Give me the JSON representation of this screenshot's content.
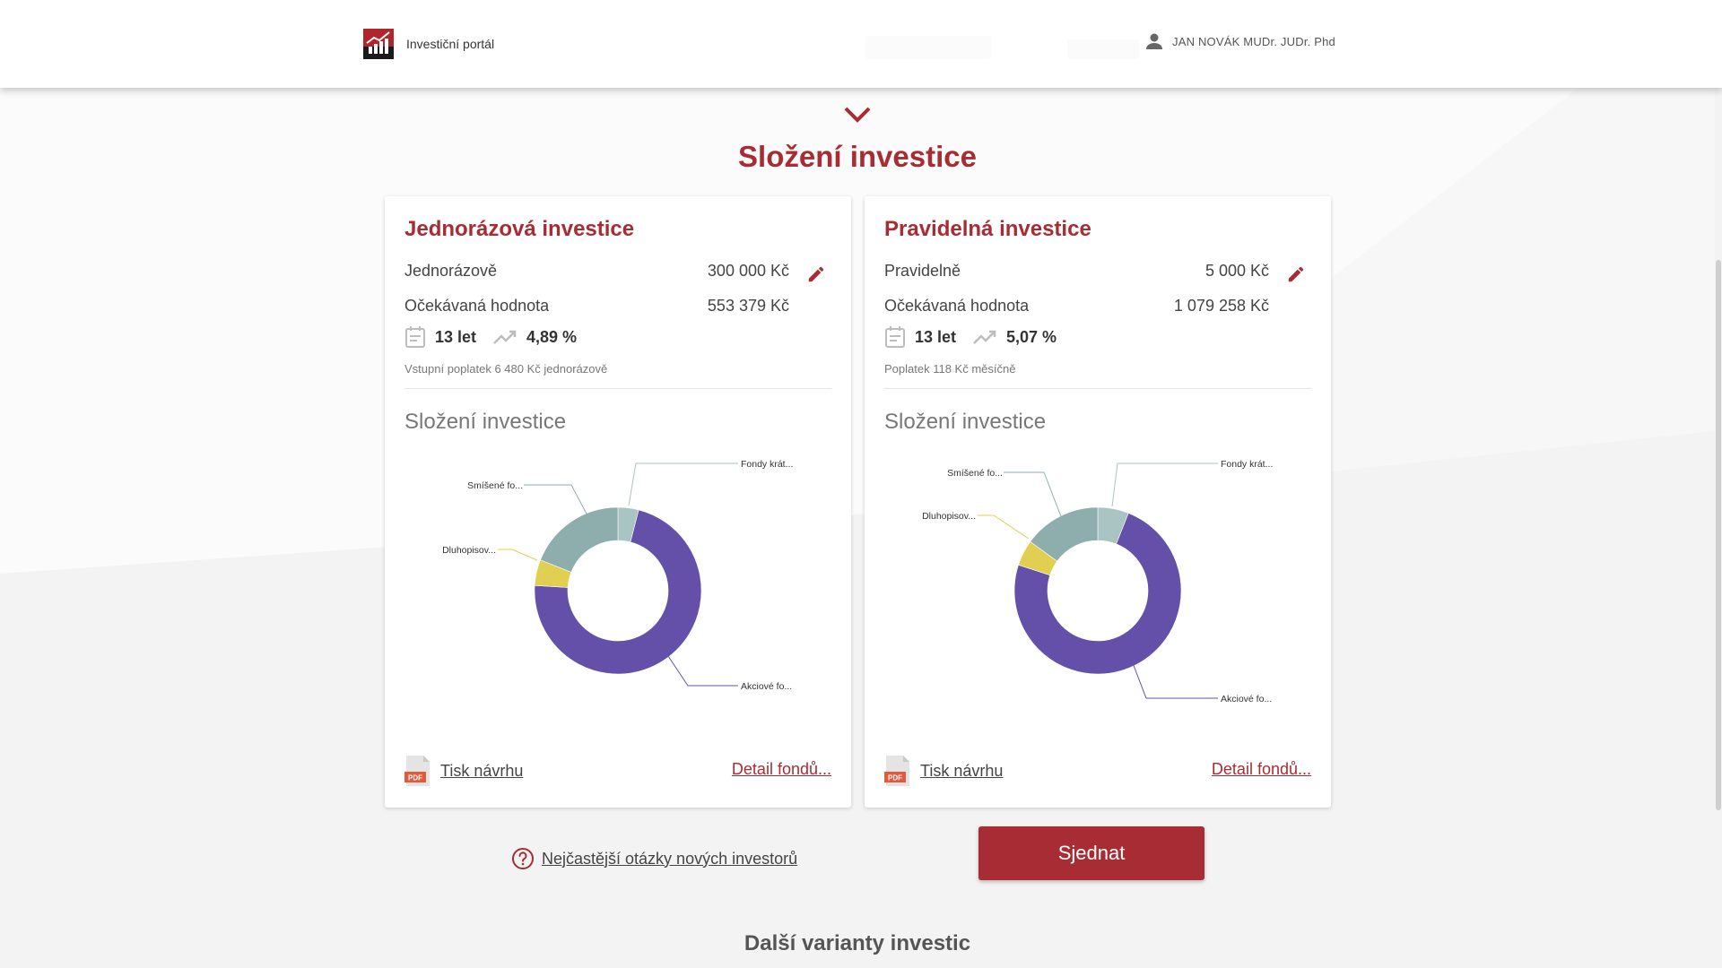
{
  "header": {
    "brand_name": "Investiční portál",
    "user_name": "JAN NOVÁK MUDr. JUDr. Phd"
  },
  "section_title": "Složení investice",
  "cards": [
    {
      "title": "Jednorázová investice",
      "amount_label": "Jednorázově",
      "amount_value": "300 000 Kč",
      "expected_label": "Očekávaná hodnota",
      "expected_value": "553 379 Kč",
      "years": "13 let",
      "rate": "4,89 %",
      "fee": "Vstupní poplatek 6 480 Kč jednorázově",
      "composition_title": "Složení investice",
      "chart_labels": {
        "short": "Fondy krát...",
        "mixed": "Smíšené fo...",
        "bond": "Dluhopisov...",
        "equity": "Akciové fo..."
      },
      "print_label": "Tisk návrhu",
      "detail_label": "Detail fondů..."
    },
    {
      "title": "Pravidelná investice",
      "amount_label": "Pravidelně",
      "amount_value": "5 000 Kč",
      "expected_label": "Očekávaná hodnota",
      "expected_value": "1 079 258 Kč",
      "years": "13 let",
      "rate": "5,07 %",
      "fee": "Poplatek 118 Kč měsíčně",
      "composition_title": "Složení investice",
      "chart_labels": {
        "short": "Fondy krát...",
        "mixed": "Smíšené fo...",
        "bond": "Dluhopisov...",
        "equity": "Akciové fo..."
      },
      "print_label": "Tisk návrhu",
      "detail_label": "Detail fondů..."
    }
  ],
  "pdf_badge": "PDF",
  "faq_label": "Nejčastější otázky nových investorů",
  "cta_label": "Sjednat",
  "more_title": "Další varianty investic",
  "colors": {
    "brand": "#a82c33",
    "equity": "#6450a8",
    "mixed": "#8eaeae",
    "bond": "#e1cf52",
    "short": "#aac3c3"
  },
  "chart_data": [
    {
      "type": "pie",
      "title": "Složení investice",
      "categories": [
        "Fondy krát...",
        "Akciové fo...",
        "Dluhopisov...",
        "Smíšené fo..."
      ],
      "values": [
        4,
        72,
        5,
        19
      ]
    },
    {
      "type": "pie",
      "title": "Složení investice",
      "categories": [
        "Fondy krát...",
        "Akciové fo...",
        "Dluhopisov...",
        "Smíšené fo..."
      ],
      "values": [
        6,
        74,
        5,
        15
      ]
    }
  ]
}
